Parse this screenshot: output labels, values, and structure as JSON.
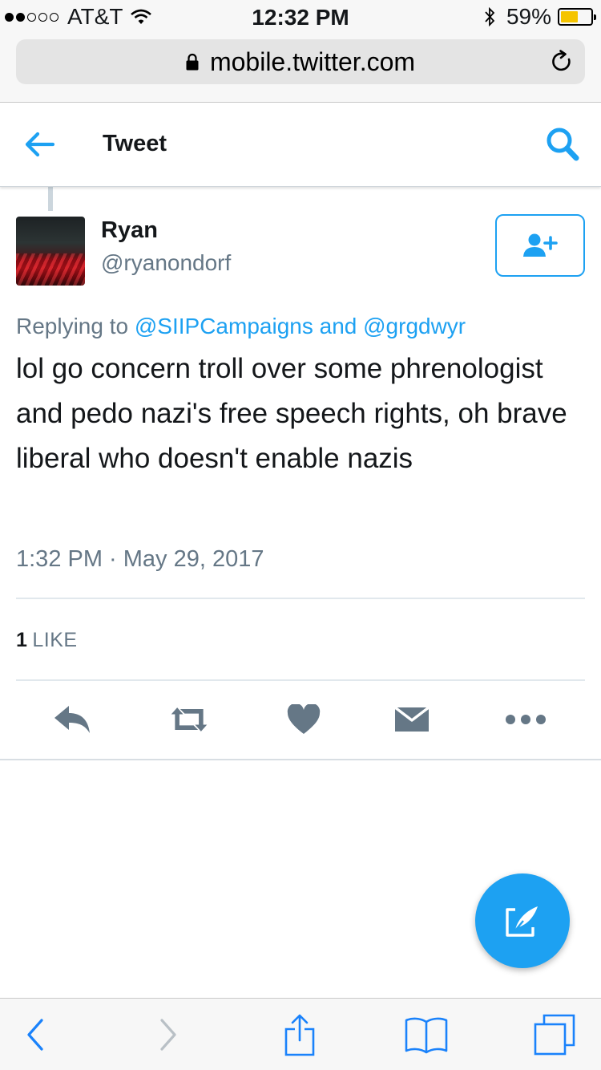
{
  "status_bar": {
    "carrier": "AT&T",
    "signal_bars_filled": 2,
    "signal_bars_total": 5,
    "time": "12:32 PM",
    "battery_percent": "59%",
    "battery_level": 0.59,
    "battery_color": "#f5c400"
  },
  "browser": {
    "url": "mobile.twitter.com",
    "icons": [
      "lock-icon",
      "reload-icon"
    ]
  },
  "header": {
    "title": "Tweet",
    "icons": [
      "back-arrow-icon",
      "search-icon"
    ]
  },
  "tweet": {
    "author_name": "Ryan",
    "author_handle": "@ryanondorf",
    "reply_prefix": "Replying to",
    "reply_mention_1": "@SIIPCampaigns",
    "reply_and": "and",
    "reply_mention_2": "@grgdwyr",
    "text": "lol go concern troll over some phrenologist and pedo nazi's free speech rights, oh brave liberal who doesn't enable nazis",
    "timestamp": "1:32 PM · May 29, 2017",
    "like_count": "1",
    "like_label": "LIKE",
    "actions": [
      "reply-icon",
      "retweet-icon",
      "like-heart-icon",
      "direct-message-icon",
      "more-options-icon"
    ]
  },
  "compose": {
    "icon": "compose-tweet-icon"
  },
  "safari_toolbar": {
    "icons": [
      "back-icon",
      "forward-icon",
      "share-icon",
      "bookmarks-icon",
      "tabs-icon"
    ]
  },
  "colors": {
    "twitter_blue": "#1da1f2",
    "text_primary": "#14171a",
    "text_secondary": "#657786",
    "action_gray": "#657786",
    "safari_blue": "#1a82fb",
    "divider": "#e1e8ed"
  }
}
